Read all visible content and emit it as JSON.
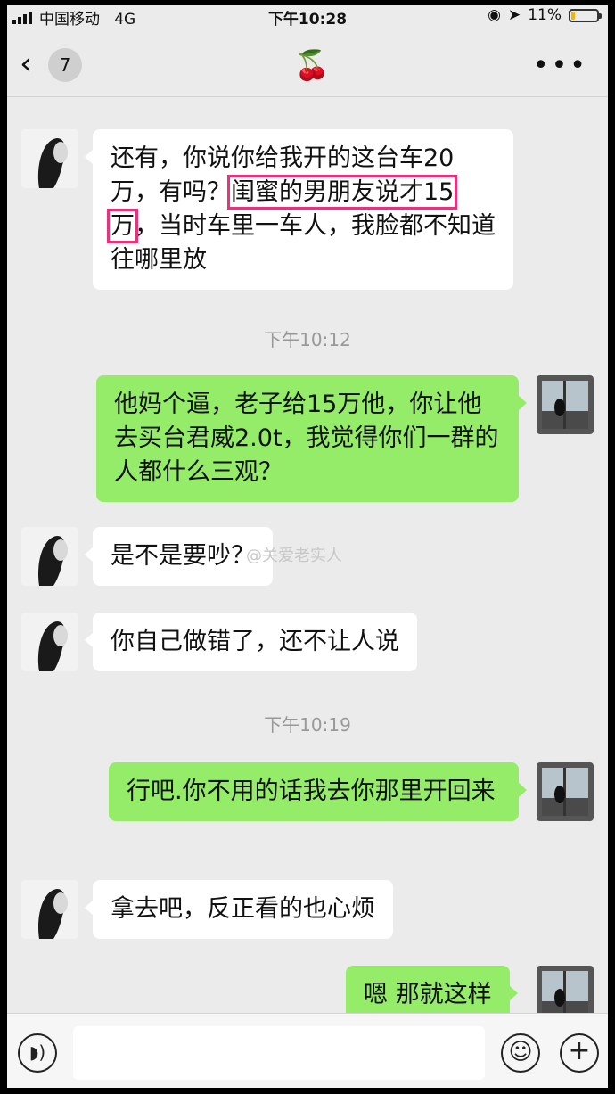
{
  "status_bar": {
    "carrier": "中国移动",
    "network": "4G",
    "time": "下午10:28",
    "battery": "11%",
    "battery_level": 0.11
  },
  "nav": {
    "back_count": "7",
    "title_emoji": "🍒",
    "more": "•••"
  },
  "messages": [
    {
      "from": "friend",
      "segments": [
        "还有，你说你给我开的这台车20万，有吗？",
        "闺蜜的男朋友说才15",
        "万",
        "，当时车里一车人，我脸都不知道往哪里放"
      ]
    },
    {
      "time": "下午10:12"
    },
    {
      "from": "me",
      "text": "他妈个逼，老子给15万他，你让他去买台君威2.0t，我觉得你们一群的人都什么三观？"
    },
    {
      "from": "friend",
      "text": "是不是要吵？"
    },
    {
      "from": "friend",
      "text": "你自己做错了，还不让人说"
    },
    {
      "time": "下午10:19"
    },
    {
      "from": "me",
      "text": " 行吧.你不用的话我去你那里开回来"
    },
    {
      "from": "friend",
      "text": "拿去吧，反正看的也心烦"
    },
    {
      "from": "me",
      "text": "嗯 那就这样"
    }
  ],
  "watermark": "@关爱老实人",
  "input_bar": {
    "placeholder": "",
    "voice_icon": "voice-icon",
    "emoji_icon": "emoji-icon",
    "add_icon": "plus-icon"
  },
  "colors": {
    "bubble_out": "#95ec69",
    "bubble_in": "#ffffff",
    "highlight": "#e8337a"
  }
}
